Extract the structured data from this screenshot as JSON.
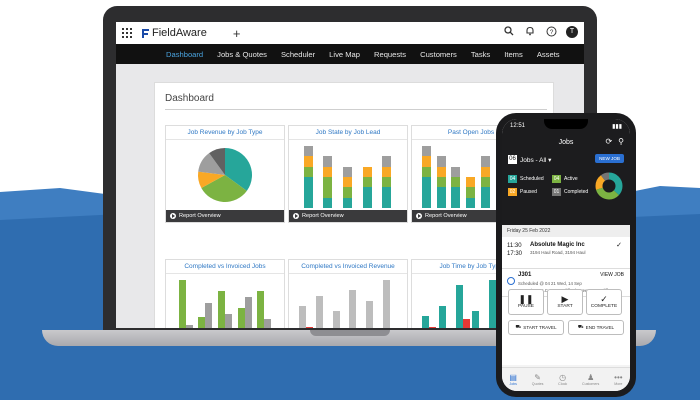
{
  "app": {
    "name": "FieldAware"
  },
  "colors": {
    "accent": "#4aa3df",
    "brand_blue": "#2a6fd1",
    "teal": "#26a69a",
    "green": "#7cb342",
    "gray": "#9e9e9e",
    "yellow": "#f9a825"
  },
  "topbar": {
    "icons": [
      "grid-icon",
      "plus-icon",
      "search-icon",
      "bell-icon",
      "help-icon"
    ],
    "avatar_initial": "T"
  },
  "nav": {
    "items": [
      "Dashboard",
      "Jobs & Quotes",
      "Scheduler",
      "Live Map",
      "Requests",
      "Customers",
      "Tasks",
      "Items",
      "Assets"
    ],
    "active_index": 0
  },
  "dashboard": {
    "title": "Dashboard",
    "cards": [
      {
        "title": "Job Revenue by Job Type",
        "footer": "Report Overview"
      },
      {
        "title": "Job State by Job Lead",
        "footer": "Report Overview"
      },
      {
        "title": "Past Open Jobs",
        "footer": "Report Overview"
      },
      {
        "title": "Completed vs Invoiced Jobs"
      },
      {
        "title": "Completed vs Invoiced Revenue"
      },
      {
        "title": "Job Time by Job Type"
      }
    ]
  },
  "phone": {
    "status_time": "12:51",
    "header_title": "Jobs",
    "jobs_count": "06",
    "jobs_filter": "Jobs - All",
    "new_job_label": "NEW JOB",
    "stats": [
      {
        "count": "04",
        "label": "Scheduled",
        "color": "#26a69a"
      },
      {
        "count": "04",
        "label": "Active",
        "color": "#7cb342"
      },
      {
        "count": "02",
        "label": "Paused",
        "color": "#f9a825"
      },
      {
        "count": "01",
        "label": "Completed",
        "color": "#757575"
      }
    ],
    "date_label": "Friday",
    "date_value": "25 Feb 2022",
    "appointment": {
      "time": "11:30",
      "time_end": "17:30",
      "name": "Absolute Magic Inc",
      "address": "3194 Haul Road, 3194 Haul"
    },
    "job": {
      "id": "J301",
      "view_label": "VIEW JOB",
      "scheduled": "Scheduled @ 04 21 Wed, 14 Sep",
      "customer": "Curtaniasa LLC - 3088 Clifford Street,3088 Cliffor"
    },
    "actions": [
      {
        "label": "PAUSE",
        "icon": "pause-icon"
      },
      {
        "label": "START",
        "icon": "play-icon"
      },
      {
        "label": "COMPLETE",
        "icon": "check-icon"
      }
    ],
    "travel": {
      "start": "START TRAVEL",
      "end": "END TRAVEL"
    },
    "tabs": [
      {
        "label": "Jobs",
        "icon": "jobs-icon"
      },
      {
        "label": "Quotes",
        "icon": "quotes-icon"
      },
      {
        "label": "Clock",
        "icon": "clock-icon"
      },
      {
        "label": "Customers",
        "icon": "customers-icon"
      },
      {
        "label": "More",
        "icon": "more-icon"
      }
    ]
  },
  "chart_data": [
    {
      "type": "pie",
      "title": "Job Revenue by Job Type",
      "values": [
        35,
        32,
        10,
        13,
        10
      ],
      "colors": [
        "#26a69a",
        "#7cb342",
        "#f9a825",
        "#9e9e9e",
        "#616161"
      ]
    },
    {
      "type": "bar",
      "title": "Job State by Job Lead",
      "stacked": true,
      "series": [
        {
          "values": [
            3,
            1,
            1,
            2,
            2
          ],
          "color": "#26a69a"
        },
        {
          "values": [
            1,
            2,
            1,
            1,
            1
          ],
          "color": "#7cb342"
        },
        {
          "values": [
            1,
            1,
            1,
            1,
            1
          ],
          "color": "#f9a825"
        },
        {
          "values": [
            1,
            1,
            1,
            0,
            1
          ],
          "color": "#9e9e9e"
        }
      ]
    },
    {
      "type": "bar",
      "title": "Past Open Jobs",
      "stacked": true,
      "series": [
        {
          "values": [
            3,
            2,
            2,
            1,
            2,
            1,
            1
          ],
          "color": "#26a69a"
        },
        {
          "values": [
            1,
            1,
            1,
            1,
            1,
            1,
            0
          ],
          "color": "#7cb342"
        },
        {
          "values": [
            1,
            1,
            0,
            1,
            1,
            0,
            1
          ],
          "color": "#f9a825"
        },
        {
          "values": [
            1,
            1,
            1,
            0,
            1,
            1,
            1
          ],
          "color": "#9e9e9e"
        }
      ]
    },
    {
      "type": "bar",
      "title": "Completed vs Invoiced Jobs",
      "series": [
        {
          "values": [
            22,
            9,
            18,
            12,
            18
          ],
          "color": "#7cb342"
        },
        {
          "values": [
            6,
            14,
            10,
            16,
            8
          ],
          "color": "#9e9e9e"
        }
      ]
    },
    {
      "type": "bar",
      "title": "Completed vs Invoiced Revenue",
      "series": [
        {
          "values": [
            14,
            18,
            12,
            20,
            16,
            24
          ],
          "color": "#bdbdbd"
        },
        {
          "values": [
            6,
            4,
            5,
            3,
            5,
            4
          ],
          "color": "#e53935"
        }
      ]
    },
    {
      "type": "bar",
      "title": "Job Time by Job Type",
      "series": [
        {
          "values": [
            10,
            14,
            22,
            12,
            24,
            16
          ],
          "color": "#26a69a"
        },
        {
          "values": [
            6,
            5,
            9,
            4,
            8,
            6
          ],
          "color": "#e53935"
        }
      ]
    }
  ]
}
